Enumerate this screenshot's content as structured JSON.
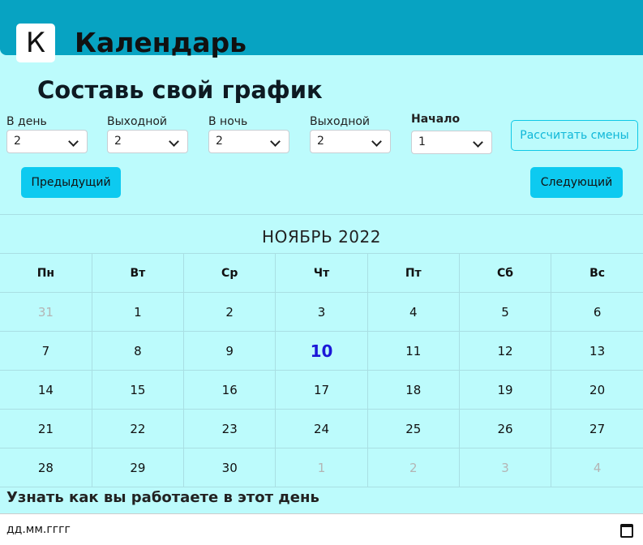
{
  "header": {
    "logo": "К",
    "title": "Календарь"
  },
  "page_title": "Составь свой график",
  "fields": [
    {
      "label": "В день",
      "value": "2"
    },
    {
      "label": "Выходной",
      "value": "2"
    },
    {
      "label": "В ночь",
      "value": "2"
    },
    {
      "label": "Выходной",
      "value": "2"
    },
    {
      "label": "Начало",
      "value": "1"
    }
  ],
  "buttons": {
    "calculate": "Рассчитать смены",
    "prev": "Предыдущий",
    "next": "Следующий"
  },
  "calendar": {
    "month_title": "НОЯБРЬ 2022",
    "weekdays": [
      "Пн",
      "Вт",
      "Ср",
      "Чт",
      "Пт",
      "Сб",
      "Вс"
    ],
    "weeks": [
      [
        "31",
        "1",
        "2",
        "3",
        "4",
        "5",
        "6"
      ],
      [
        "7",
        "8",
        "9",
        "10",
        "11",
        "12",
        "13"
      ],
      [
        "14",
        "15",
        "16",
        "17",
        "18",
        "19",
        "20"
      ],
      [
        "21",
        "22",
        "23",
        "24",
        "25",
        "26",
        "27"
      ],
      [
        "28",
        "29",
        "30",
        "1",
        "2",
        "3",
        "4"
      ]
    ],
    "today": "10"
  },
  "lookup": {
    "label": "Узнать как вы работаете в этот день",
    "placeholder": "дд.мм.гггг"
  },
  "colors": {
    "header": "#07a3c2",
    "background": "#bcfbfc",
    "accent": "#0dcaf0",
    "today": "#1c17d8"
  },
  "icons": {
    "date": "calendar-icon",
    "select": "chevron-down-icon"
  }
}
